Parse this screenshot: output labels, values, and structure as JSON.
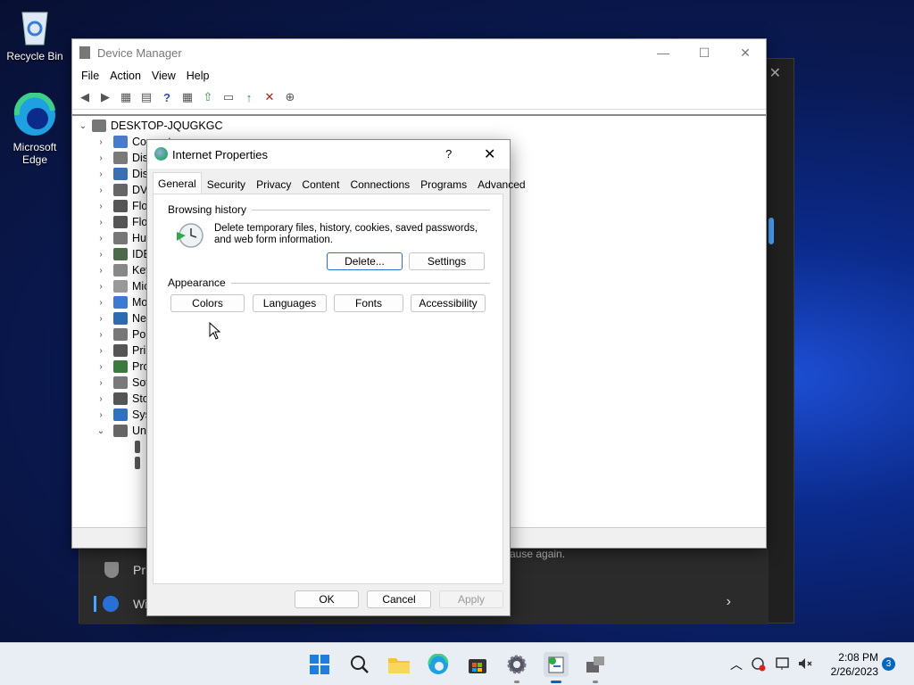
{
  "desktop": {
    "icons": [
      {
        "label": "Recycle Bin"
      },
      {
        "label": "Microsoft Edge"
      }
    ]
  },
  "background_window": {
    "text_fragment": "ause again.",
    "item1_fragment": "Pri",
    "item2_fragment": "Wi"
  },
  "device_manager": {
    "title": "Device Manager",
    "menu": [
      "File",
      "Action",
      "View",
      "Help"
    ],
    "root": "DESKTOP-JQUGKGC",
    "items": [
      "Computer",
      "Disk",
      "Disp",
      "DVD",
      "Flop",
      "Flop",
      "Hun",
      "IDE",
      "Keyb",
      "Mic",
      "Mon",
      "Netv",
      "Port",
      "Prin",
      "Proc",
      "Soft",
      "Stor",
      "Syst",
      "Univ"
    ],
    "item_colors": [
      "#4a7bc8",
      "#7a7a7a",
      "#3b6fb5",
      "#666",
      "#555",
      "#555",
      "#777",
      "#4d6a4d",
      "#888",
      "#999",
      "#3b7bd4",
      "#2d6bb3",
      "#777",
      "#555",
      "#3d7a3d",
      "#7a7a7a",
      "#555",
      "#2f72c4",
      "#666"
    ]
  },
  "dialog": {
    "title": "Internet Properties",
    "help": "?",
    "tabs": [
      "General",
      "Security",
      "Privacy",
      "Content",
      "Connections",
      "Programs",
      "Advanced"
    ],
    "browsing_history": {
      "header": "Browsing history",
      "description_line1": "Delete temporary files, history, cookies, saved passwords,",
      "description_line2": "and web form information.",
      "delete_label": "Delete...",
      "settings_label": "Settings"
    },
    "appearance": {
      "header": "Appearance",
      "buttons": [
        "Colors",
        "Languages",
        "Fonts",
        "Accessibility"
      ]
    },
    "ok_label": "OK",
    "cancel_label": "Cancel",
    "apply_label": "Apply"
  },
  "taskbar": {
    "time": "2:08 PM",
    "date": "2/26/2023",
    "notification_count": "3"
  },
  "colors": {
    "accent": "#0067c0",
    "dialog_bg": "#f0f0f0"
  }
}
